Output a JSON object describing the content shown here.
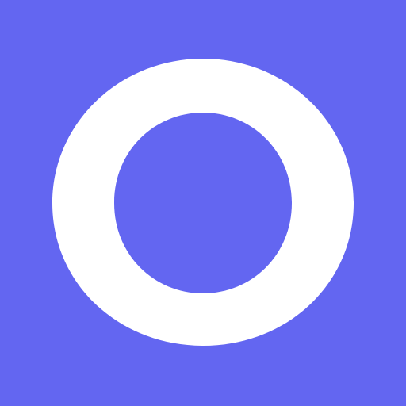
{
  "app_icon": {
    "background_color": "#6366F1",
    "glyph_color": "#FFFFFF",
    "glyph": "O",
    "icon_name": "letter-o-logo-icon"
  }
}
